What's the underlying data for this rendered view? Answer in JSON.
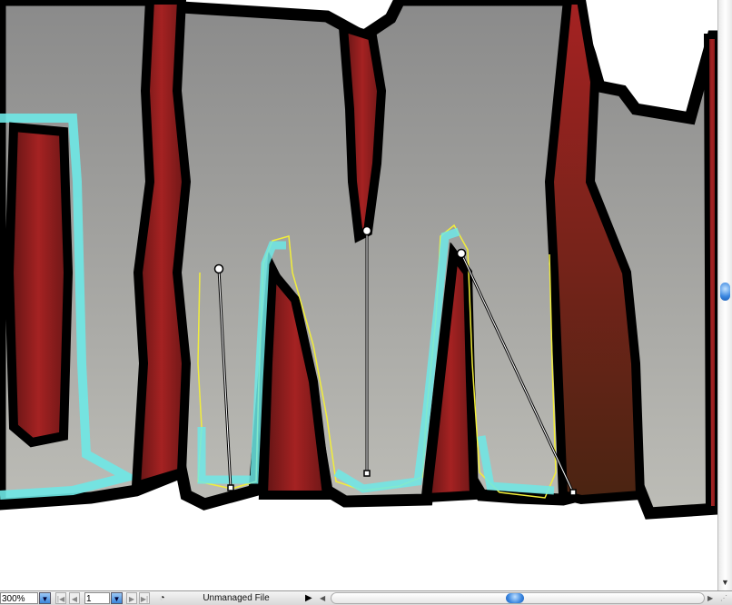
{
  "status_bar": {
    "zoom_value": "300%",
    "page_value": "1",
    "status_label": "Unmanaged File",
    "first_page_icon": "first-page-icon",
    "prev_page_icon": "prev-page-icon",
    "next_page_icon": "next-page-icon",
    "last_page_icon": "last-page-icon"
  },
  "colors": {
    "gray_top": "#8a8a8a",
    "gray_bottom": "#b9b9b3",
    "red": "#9a1e1e",
    "red_dark": "#4a2412",
    "cyan": "#6ee8e6",
    "path_yellow": "#f2ee3a",
    "accent_blue": "#3a86db"
  }
}
